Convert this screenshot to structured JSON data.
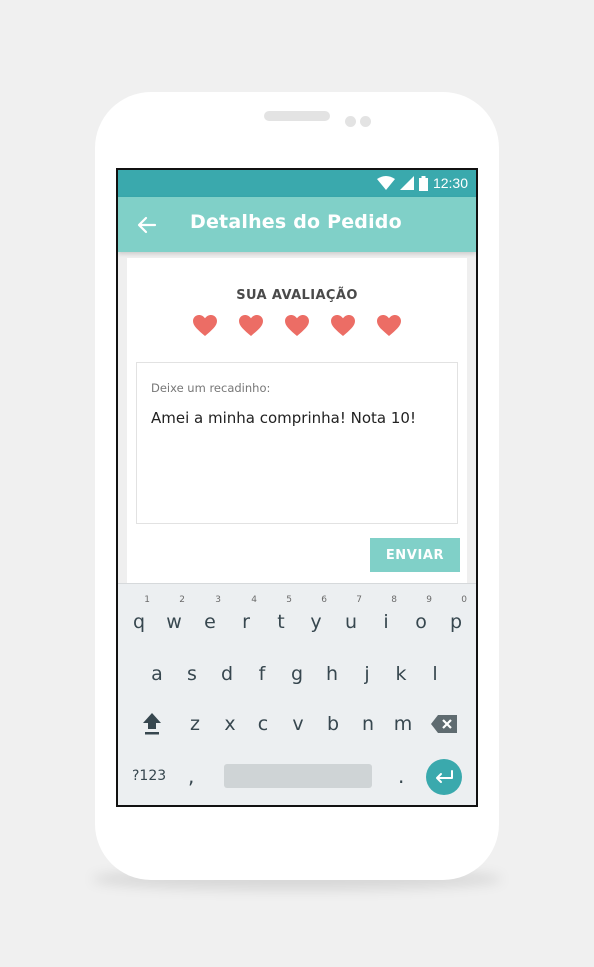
{
  "status_bar": {
    "time": "12:30",
    "wifi_icon": "wifi-icon",
    "signal_icon": "signal-icon",
    "battery_icon": "battery-icon"
  },
  "app_bar": {
    "title": "Detalhes do Pedido",
    "back_icon": "arrow-left-icon"
  },
  "rating": {
    "label": "SUA AVALIAÇÃO",
    "value": 5,
    "max": 5,
    "color": "#ec6d65"
  },
  "note": {
    "label": "Deixe um recadinho:",
    "value": "Amei a minha comprinha! Nota 10!"
  },
  "send_button": {
    "label": "ENVIAR"
  },
  "colors": {
    "status": "#3aa9ad",
    "appbar": "#80d0c8",
    "accent": "#3aa9ad"
  },
  "keyboard": {
    "row1": [
      {
        "ch": "q",
        "hint": "1"
      },
      {
        "ch": "w",
        "hint": "2"
      },
      {
        "ch": "e",
        "hint": "3"
      },
      {
        "ch": "r",
        "hint": "4"
      },
      {
        "ch": "t",
        "hint": "5"
      },
      {
        "ch": "y",
        "hint": "6"
      },
      {
        "ch": "u",
        "hint": "7"
      },
      {
        "ch": "i",
        "hint": "8"
      },
      {
        "ch": "o",
        "hint": "9"
      },
      {
        "ch": "p",
        "hint": "0"
      }
    ],
    "row2": [
      "a",
      "s",
      "d",
      "f",
      "g",
      "h",
      "j",
      "k",
      "l"
    ],
    "row3": [
      "z",
      "x",
      "c",
      "v",
      "b",
      "n",
      "m"
    ],
    "symbols_label": "?123",
    "comma": ",",
    "period": ".",
    "shift_icon": "shift-icon",
    "delete_icon": "backspace-icon",
    "enter_icon": "enter-icon"
  }
}
